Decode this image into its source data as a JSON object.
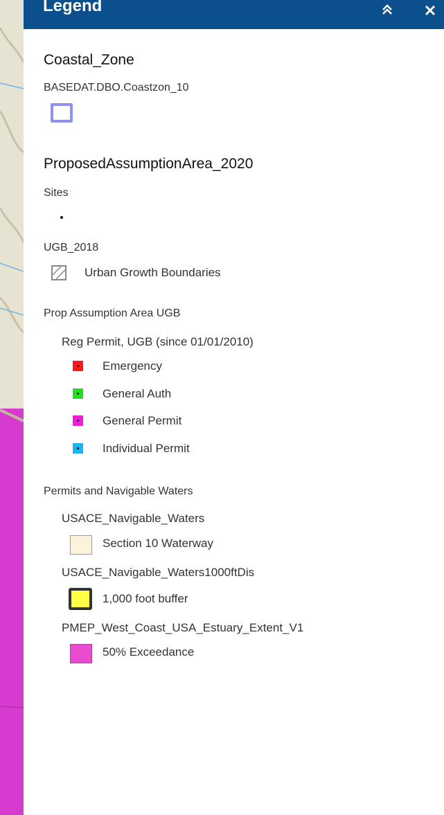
{
  "header": {
    "title": "Legend",
    "collapse_icon": "double-chevron-up-icon",
    "close_icon": "close-icon"
  },
  "colors": {
    "header_bg": "#0b4f8c",
    "map_purple": "#d63bcf",
    "map_terrain": "#e6e3d2"
  },
  "legend": {
    "coastal_zone": {
      "title": "Coastal_Zone",
      "sublayer": "BASEDAT.DBO.Coastzon_10",
      "symbol_color": "#8d90f5"
    },
    "proposed": {
      "title": "ProposedAssumptionArea_2020",
      "sites_label": "Sites",
      "ugb_layer": "UGB_2018",
      "ugb_item": "Urban Growth Boundaries",
      "prop_layer": "Prop Assumption Area UGB",
      "reg_permit_label": "Reg Permit, UGB (since 01/01/2010)",
      "permit_items": [
        {
          "label": "Emergency",
          "color": "#ff1a1a"
        },
        {
          "label": "General Auth",
          "color": "#22dd22"
        },
        {
          "label": "General Permit",
          "color": "#f01ad8"
        },
        {
          "label": "Individual Permit",
          "color": "#1ab4f0"
        }
      ]
    },
    "navigable": {
      "group": "Permits and Navigable Waters",
      "waters_layer": "USACE_Navigable_Waters",
      "waters_item": "Section 10 Waterway",
      "waters_color": "#fdf2dc",
      "buffer_layer": "USACE_Navigable_Waters1000ftDis",
      "buffer_item": "1,000 foot buffer",
      "buffer_color": "#ffff44",
      "pmep_layer": "PMEP_West_Coast_USA_Estuary_Extent_V1",
      "pmep_item": "50% Exceedance",
      "pmep_color": "#ea4ccf"
    }
  }
}
